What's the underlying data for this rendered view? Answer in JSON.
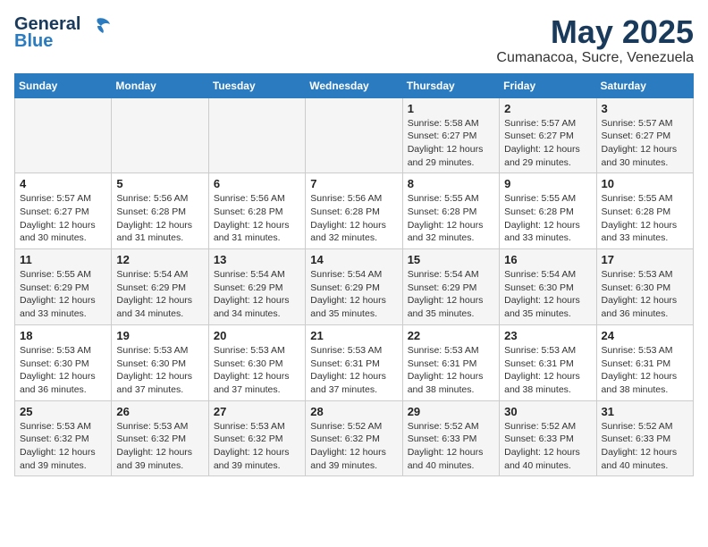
{
  "logo": {
    "general": "General",
    "blue": "Blue"
  },
  "title": "May 2025",
  "subtitle": "Cumanacoa, Sucre, Venezuela",
  "days_of_week": [
    "Sunday",
    "Monday",
    "Tuesday",
    "Wednesday",
    "Thursday",
    "Friday",
    "Saturday"
  ],
  "weeks": [
    [
      {
        "day": "",
        "info": ""
      },
      {
        "day": "",
        "info": ""
      },
      {
        "day": "",
        "info": ""
      },
      {
        "day": "",
        "info": ""
      },
      {
        "day": "1",
        "info": "Sunrise: 5:58 AM\nSunset: 6:27 PM\nDaylight: 12 hours\nand 29 minutes."
      },
      {
        "day": "2",
        "info": "Sunrise: 5:57 AM\nSunset: 6:27 PM\nDaylight: 12 hours\nand 29 minutes."
      },
      {
        "day": "3",
        "info": "Sunrise: 5:57 AM\nSunset: 6:27 PM\nDaylight: 12 hours\nand 30 minutes."
      }
    ],
    [
      {
        "day": "4",
        "info": "Sunrise: 5:57 AM\nSunset: 6:27 PM\nDaylight: 12 hours\nand 30 minutes."
      },
      {
        "day": "5",
        "info": "Sunrise: 5:56 AM\nSunset: 6:28 PM\nDaylight: 12 hours\nand 31 minutes."
      },
      {
        "day": "6",
        "info": "Sunrise: 5:56 AM\nSunset: 6:28 PM\nDaylight: 12 hours\nand 31 minutes."
      },
      {
        "day": "7",
        "info": "Sunrise: 5:56 AM\nSunset: 6:28 PM\nDaylight: 12 hours\nand 32 minutes."
      },
      {
        "day": "8",
        "info": "Sunrise: 5:55 AM\nSunset: 6:28 PM\nDaylight: 12 hours\nand 32 minutes."
      },
      {
        "day": "9",
        "info": "Sunrise: 5:55 AM\nSunset: 6:28 PM\nDaylight: 12 hours\nand 33 minutes."
      },
      {
        "day": "10",
        "info": "Sunrise: 5:55 AM\nSunset: 6:28 PM\nDaylight: 12 hours\nand 33 minutes."
      }
    ],
    [
      {
        "day": "11",
        "info": "Sunrise: 5:55 AM\nSunset: 6:29 PM\nDaylight: 12 hours\nand 33 minutes."
      },
      {
        "day": "12",
        "info": "Sunrise: 5:54 AM\nSunset: 6:29 PM\nDaylight: 12 hours\nand 34 minutes."
      },
      {
        "day": "13",
        "info": "Sunrise: 5:54 AM\nSunset: 6:29 PM\nDaylight: 12 hours\nand 34 minutes."
      },
      {
        "day": "14",
        "info": "Sunrise: 5:54 AM\nSunset: 6:29 PM\nDaylight: 12 hours\nand 35 minutes."
      },
      {
        "day": "15",
        "info": "Sunrise: 5:54 AM\nSunset: 6:29 PM\nDaylight: 12 hours\nand 35 minutes."
      },
      {
        "day": "16",
        "info": "Sunrise: 5:54 AM\nSunset: 6:30 PM\nDaylight: 12 hours\nand 35 minutes."
      },
      {
        "day": "17",
        "info": "Sunrise: 5:53 AM\nSunset: 6:30 PM\nDaylight: 12 hours\nand 36 minutes."
      }
    ],
    [
      {
        "day": "18",
        "info": "Sunrise: 5:53 AM\nSunset: 6:30 PM\nDaylight: 12 hours\nand 36 minutes."
      },
      {
        "day": "19",
        "info": "Sunrise: 5:53 AM\nSunset: 6:30 PM\nDaylight: 12 hours\nand 37 minutes."
      },
      {
        "day": "20",
        "info": "Sunrise: 5:53 AM\nSunset: 6:30 PM\nDaylight: 12 hours\nand 37 minutes."
      },
      {
        "day": "21",
        "info": "Sunrise: 5:53 AM\nSunset: 6:31 PM\nDaylight: 12 hours\nand 37 minutes."
      },
      {
        "day": "22",
        "info": "Sunrise: 5:53 AM\nSunset: 6:31 PM\nDaylight: 12 hours\nand 38 minutes."
      },
      {
        "day": "23",
        "info": "Sunrise: 5:53 AM\nSunset: 6:31 PM\nDaylight: 12 hours\nand 38 minutes."
      },
      {
        "day": "24",
        "info": "Sunrise: 5:53 AM\nSunset: 6:31 PM\nDaylight: 12 hours\nand 38 minutes."
      }
    ],
    [
      {
        "day": "25",
        "info": "Sunrise: 5:53 AM\nSunset: 6:32 PM\nDaylight: 12 hours\nand 39 minutes."
      },
      {
        "day": "26",
        "info": "Sunrise: 5:53 AM\nSunset: 6:32 PM\nDaylight: 12 hours\nand 39 minutes."
      },
      {
        "day": "27",
        "info": "Sunrise: 5:53 AM\nSunset: 6:32 PM\nDaylight: 12 hours\nand 39 minutes."
      },
      {
        "day": "28",
        "info": "Sunrise: 5:52 AM\nSunset: 6:32 PM\nDaylight: 12 hours\nand 39 minutes."
      },
      {
        "day": "29",
        "info": "Sunrise: 5:52 AM\nSunset: 6:33 PM\nDaylight: 12 hours\nand 40 minutes."
      },
      {
        "day": "30",
        "info": "Sunrise: 5:52 AM\nSunset: 6:33 PM\nDaylight: 12 hours\nand 40 minutes."
      },
      {
        "day": "31",
        "info": "Sunrise: 5:52 AM\nSunset: 6:33 PM\nDaylight: 12 hours\nand 40 minutes."
      }
    ]
  ]
}
